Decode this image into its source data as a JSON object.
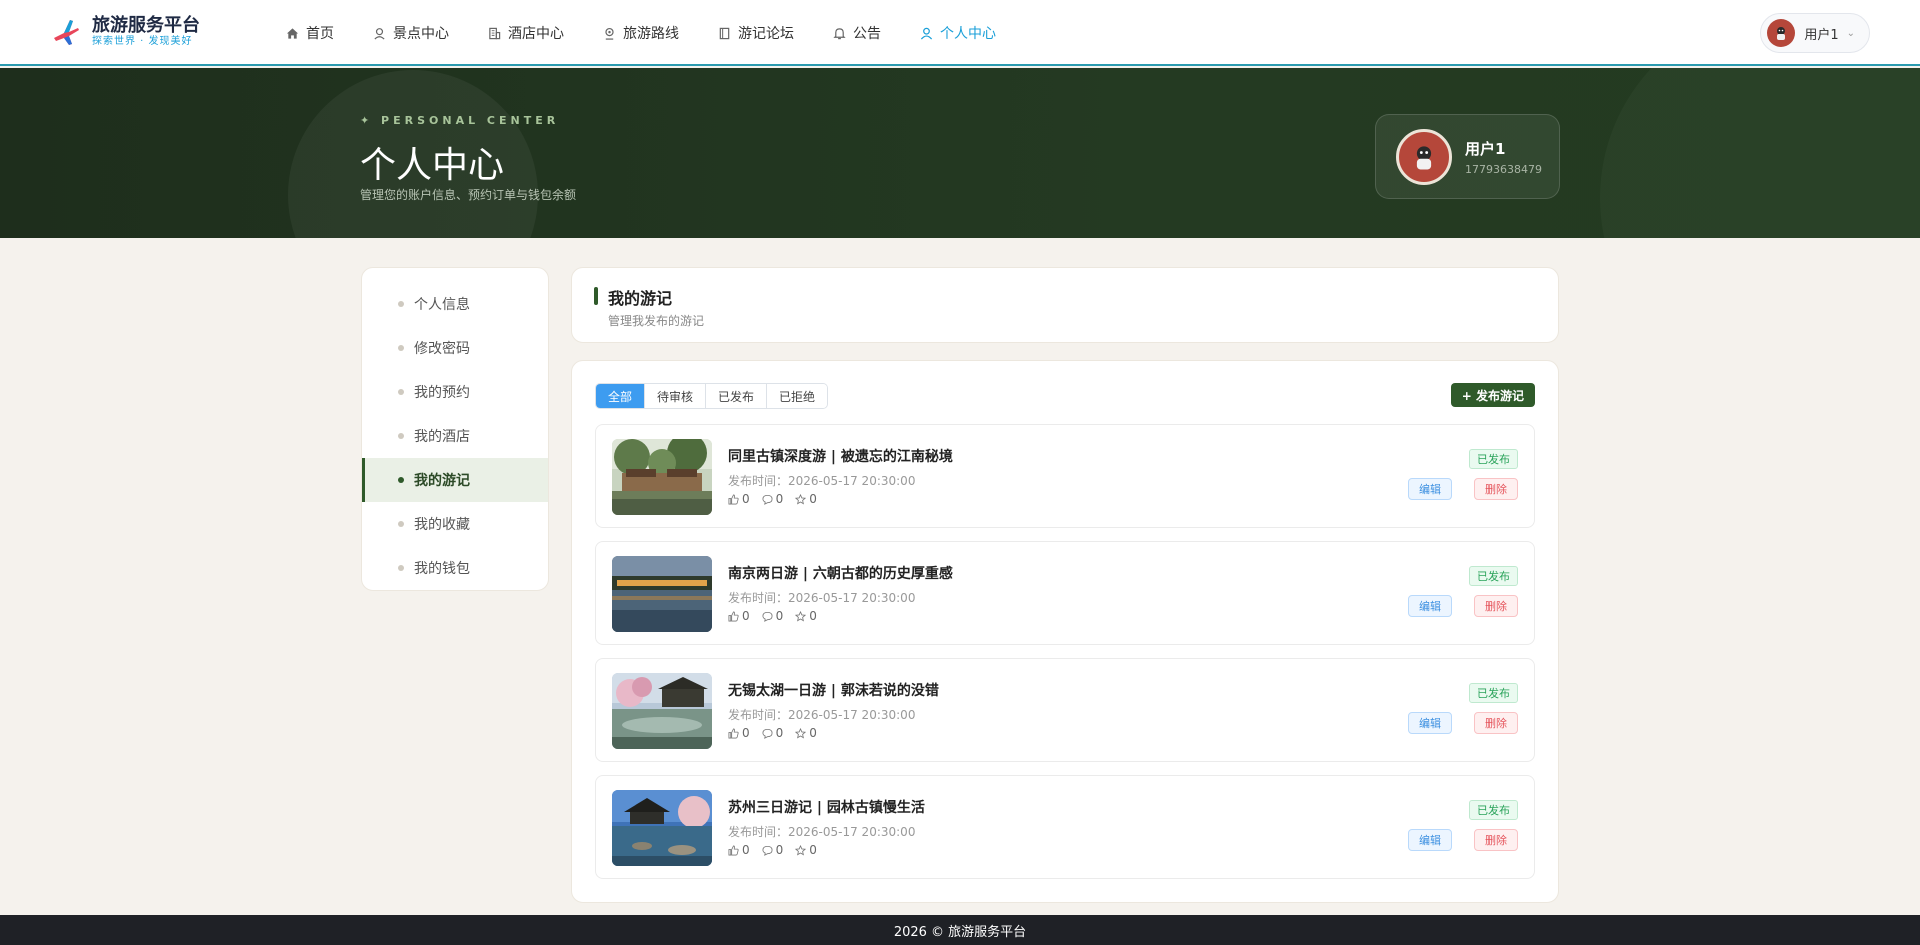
{
  "brand": {
    "title": "旅游服务平台",
    "subtitle": "探索世界 · 发现美好"
  },
  "nav": [
    {
      "label": "首页",
      "icon": "home-icon"
    },
    {
      "label": "景点中心",
      "icon": "location-icon"
    },
    {
      "label": "酒店中心",
      "icon": "building-icon"
    },
    {
      "label": "旅游路线",
      "icon": "route-icon"
    },
    {
      "label": "游记论坛",
      "icon": "book-icon"
    },
    {
      "label": "公告",
      "icon": "bell-icon"
    },
    {
      "label": "个人中心",
      "icon": "user-icon",
      "active": true
    }
  ],
  "user": {
    "name": "用户1",
    "phone": "17793638479"
  },
  "hero": {
    "eyebrow": "✦ PERSONAL CENTER",
    "title": "个人中心",
    "desc": "管理您的账户信息、预约订单与钱包余额"
  },
  "sidebar": {
    "items": [
      {
        "label": "个人信息"
      },
      {
        "label": "修改密码"
      },
      {
        "label": "我的预约"
      },
      {
        "label": "我的酒店"
      },
      {
        "label": "我的游记",
        "active": true
      },
      {
        "label": "我的收藏"
      },
      {
        "label": "我的钱包"
      }
    ]
  },
  "section": {
    "title": "我的游记",
    "subtitle": "管理我发布的游记"
  },
  "tabs": [
    {
      "label": "全部",
      "active": true
    },
    {
      "label": "待审核"
    },
    {
      "label": "已发布"
    },
    {
      "label": "已拒绝"
    }
  ],
  "publish_label": "+ 发布游记",
  "actions": {
    "edit": "编辑",
    "delete": "删除"
  },
  "entries": [
    {
      "title": "同里古镇深度游 | 被遗忘的江南秘境",
      "time": "发布时间：2026-05-17 20:30:00",
      "likes": "0",
      "comments": "0",
      "stars": "0",
      "status": "已发布"
    },
    {
      "title": "南京两日游 | 六朝古都的历史厚重感",
      "time": "发布时间：2026-05-17 20:30:00",
      "likes": "0",
      "comments": "0",
      "stars": "0",
      "status": "已发布"
    },
    {
      "title": "无锡太湖一日游 | 郭沫若说的没错",
      "time": "发布时间：2026-05-17 20:30:00",
      "likes": "0",
      "comments": "0",
      "stars": "0",
      "status": "已发布"
    },
    {
      "title": "苏州三日游记 | 园林古镇慢生活",
      "time": "发布时间：2026-05-17 20:30:00",
      "likes": "0",
      "comments": "0",
      "stars": "0",
      "status": "已发布"
    }
  ],
  "footer": "2026 © 旅游服务平台",
  "colors": {
    "accent": "#1a9fd8",
    "forest": "#2f5a2a",
    "hero_bg": "#1e2e1c"
  }
}
